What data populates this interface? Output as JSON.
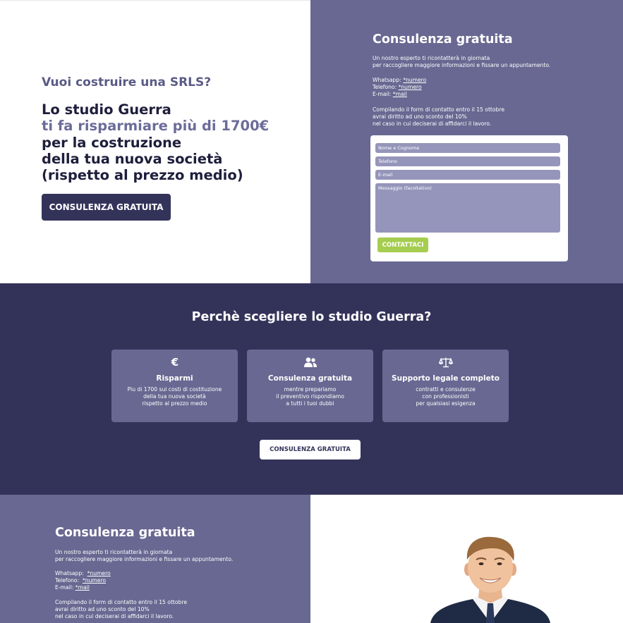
{
  "hero": {
    "eyebrow": "Vuoi costruire una SRLS?",
    "headline_1": "Lo studio Guerra",
    "headline_accent": "ti fa risparmiare più di 1700€",
    "headline_2": "per la costruzione",
    "headline_3": "della tua nuova società",
    "headline_4": "(rispetto al prezzo medio)",
    "cta_label": "CONSULENZA GRATUITA"
  },
  "contact_panel": {
    "title": "Consulenza gratuita",
    "intro_1": "Un nostro esperto ti ricontatterà in giornata",
    "intro_2": "per raccogliere maggiore informazioni e fissare un appuntamento.",
    "whatsapp_label": "Whatsapp:",
    "whatsapp_value": "*numero",
    "phone_label": "Telefono:",
    "phone_value": "*numero",
    "email_label": "E-mail:",
    "email_value": "*mail",
    "promo_1": "Compilando il form di contatto entro il 15 ottobre",
    "promo_2": "avrai diritto ad uno sconto del 10%",
    "promo_3": "nel caso in cui deciserai di affidarci il lavoro."
  },
  "form": {
    "name_placeholder": "Nome e Cognome",
    "phone_placeholder": "Telefono",
    "email_placeholder": "E-mail",
    "message_placeholder": "Messaggio (facoltativo)",
    "submit_label": "CONTATTACI"
  },
  "why": {
    "title": "Perchè scegliere lo studio Guerra?",
    "cards": [
      {
        "icon": "euro-icon",
        "title": "Risparmi",
        "line_1": "Piu di 1700 sui costi di costituzione",
        "line_2": "della tua nuova società",
        "line_3": "rispetto al prezzo medio"
      },
      {
        "icon": "users-icon",
        "title": "Consulenza gratuita",
        "line_1": "mentre prepariamo",
        "line_2": "il preventivo rispondiamo",
        "line_3": "a tutti i tuoi dubbi"
      },
      {
        "icon": "scale-icon",
        "title": "Supporto legale completo",
        "line_1": "contratti e consulenze",
        "line_2": "con professionisti",
        "line_3": "per qualsiasi esigenza"
      }
    ],
    "cta_label": "CONSULENZA GRATUITA"
  },
  "bottom": {
    "title": "Consulenza gratuita",
    "intro_1": "Un nostro esperto ti ricontatterà in giornata",
    "intro_2": "per raccogliere maggiore informazioni e fissare un appuntamento.",
    "whatsapp_label": "Whatsapp:",
    "whatsapp_value": "*numero",
    "phone_label": "Telefono:",
    "phone_value": "*numero",
    "email_label": "E-mail:",
    "email_value": "*mail",
    "promo_1": "Compilando il form di contatto entro il 15 ottobre",
    "promo_2": "avrai diritto ad uno sconto del 10%",
    "promo_3": "nel caso in cui deciserai di affidarci il lavoro."
  },
  "colors": {
    "primary_dark": "#33335a",
    "primary_mid": "#686892",
    "field_bg": "#9595bb",
    "accent_green": "#a6cd4f"
  }
}
